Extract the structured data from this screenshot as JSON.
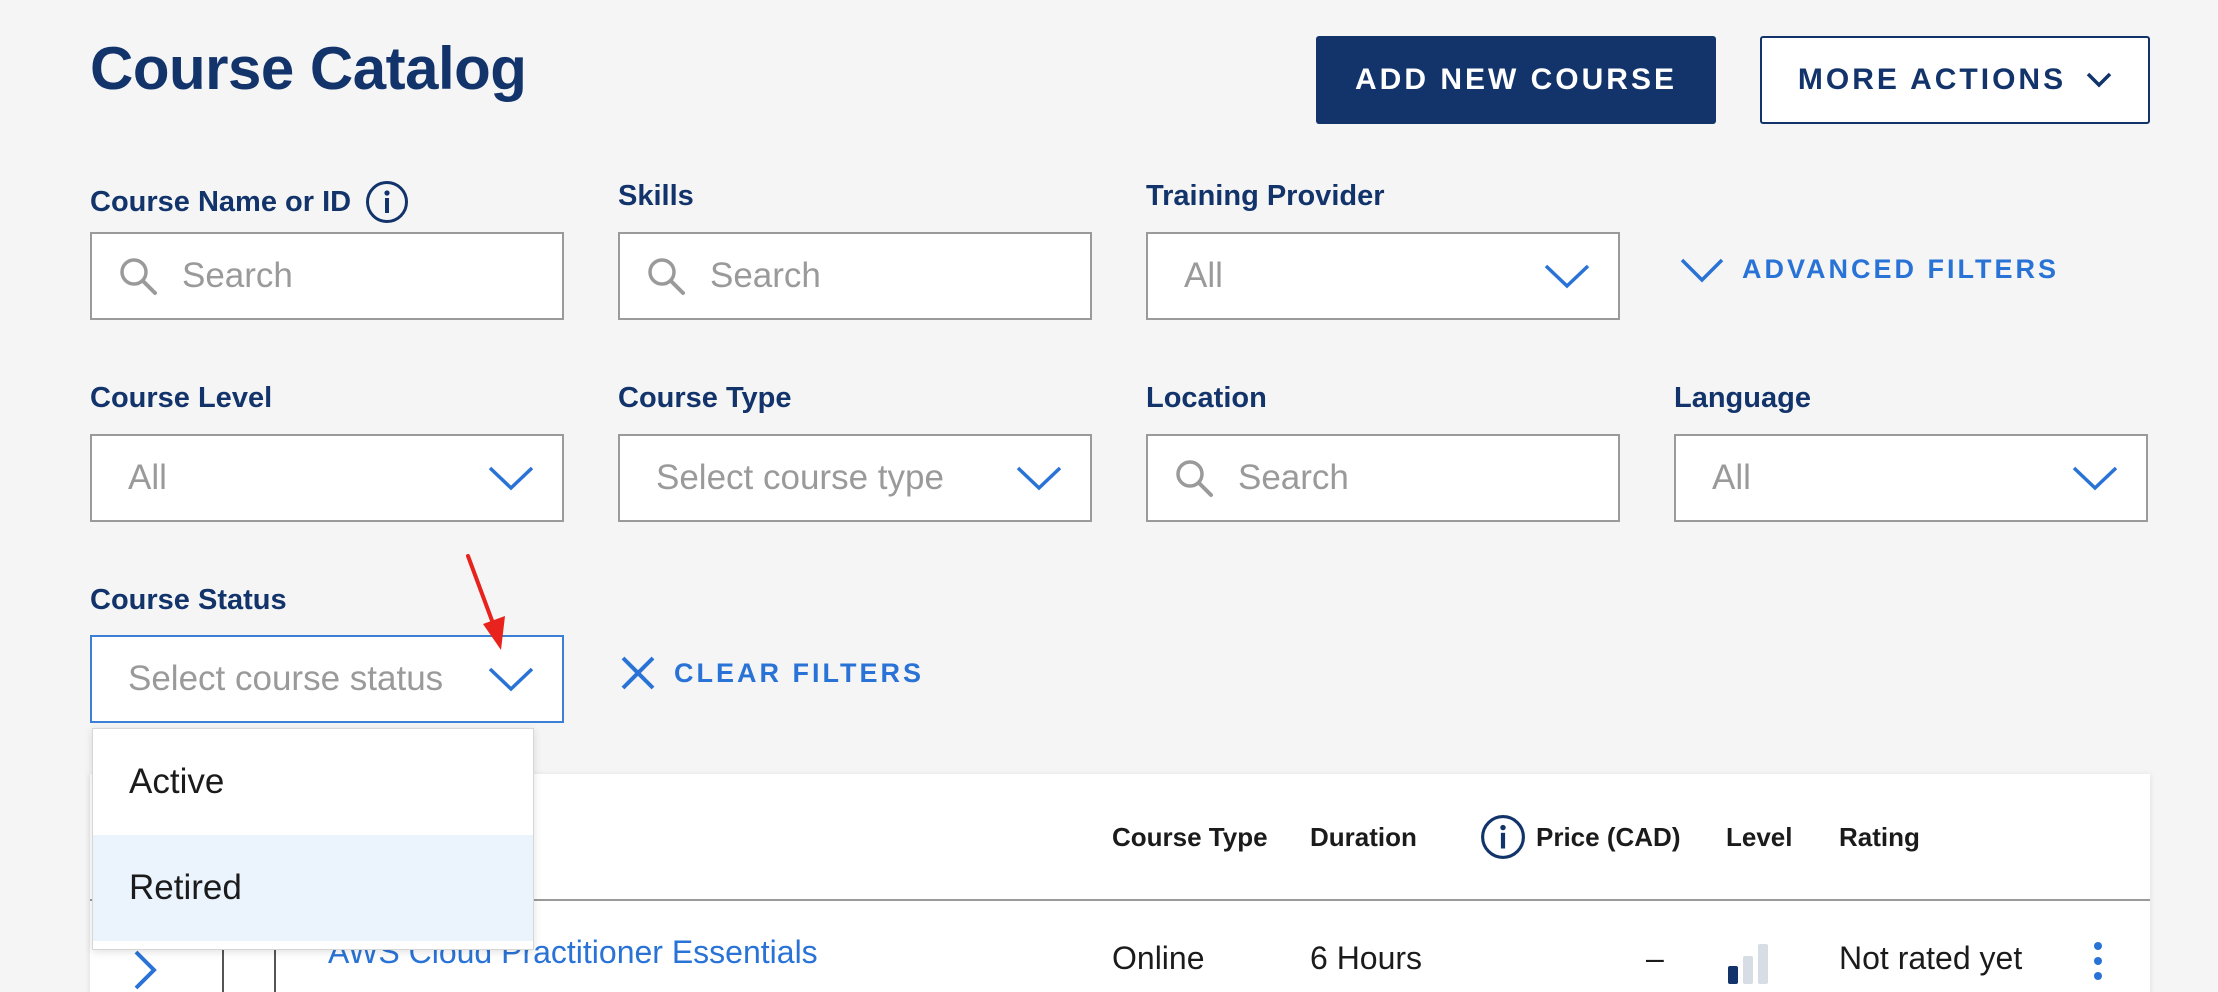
{
  "header": {
    "title": "Course Catalog",
    "add_button": "ADD NEW COURSE",
    "more_button": "MORE ACTIONS"
  },
  "filters": {
    "course_name": {
      "label": "Course Name or ID",
      "placeholder": "Search"
    },
    "skills": {
      "label": "Skills",
      "placeholder": "Search"
    },
    "training_provider": {
      "label": "Training Provider",
      "value": "All"
    },
    "advanced_filters": "ADVANCED FILTERS",
    "course_level": {
      "label": "Course Level",
      "value": "All"
    },
    "course_type": {
      "label": "Course Type",
      "value": "Select course type"
    },
    "location": {
      "label": "Location",
      "placeholder": "Search"
    },
    "language": {
      "label": "Language",
      "value": "All"
    },
    "course_status": {
      "label": "Course Status",
      "value": "Select course status",
      "options": [
        "Active",
        "Retired"
      ]
    },
    "clear_filters": "CLEAR FILTERS"
  },
  "table": {
    "headers": {
      "course_type": "Course Type",
      "duration": "Duration",
      "price": "Price (CAD)",
      "level": "Level",
      "rating": "Rating"
    },
    "rows": [
      {
        "name": "AWS Cloud Practitioner Essentials",
        "course_type": "Online",
        "duration": "6 Hours",
        "price": "–",
        "level": 1,
        "rating": "Not rated yet"
      }
    ]
  },
  "colors": {
    "navy": "#12346b",
    "link_blue": "#2a73d6",
    "annotation_red": "#e8231d"
  },
  "icons": {
    "info": "info-icon",
    "search": "search-icon",
    "chevron": "chevron-down-icon",
    "close": "close-icon",
    "kebab": "kebab-menu-icon"
  }
}
